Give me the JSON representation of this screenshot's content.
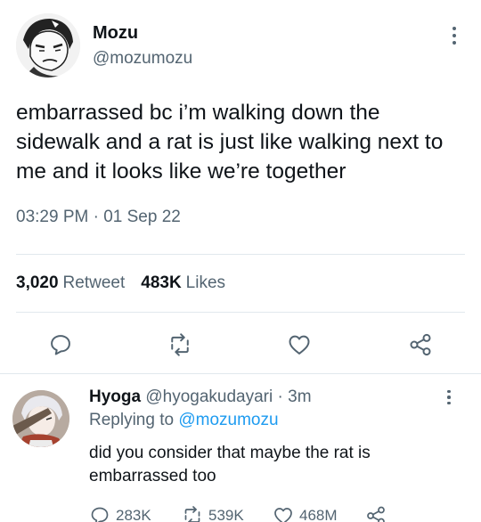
{
  "tweet": {
    "author_name": "Mozu",
    "author_handle": "@mozumozu",
    "text": "embarrassed bc i’m walking down the sidewalk and a rat is just like walking next to me and it looks like we’re together",
    "timestamp": "03:29 PM · 01 Sep 22",
    "retweets_count": "3,020",
    "retweets_label": "Retweet",
    "likes_count": "483K",
    "likes_label": "Likes",
    "actions": [
      "reply-icon",
      "retweet-icon",
      "like-icon",
      "share-icon"
    ]
  },
  "reply": {
    "author_name": "Hyoga",
    "author_handle": "@hyogakudayari",
    "separator": "·",
    "time": "3m",
    "replying_prefix": "Replying to",
    "replying_to": "@mozumozu",
    "text": "did you consider that maybe the rat is embarrassed too",
    "reply_count": "283K",
    "retweet_count": "539K",
    "like_count": "468M"
  },
  "colors": {
    "text": "#0f1419",
    "secondary": "#536471",
    "accent": "#1d9bf0",
    "divider": "#e1e8ed"
  }
}
